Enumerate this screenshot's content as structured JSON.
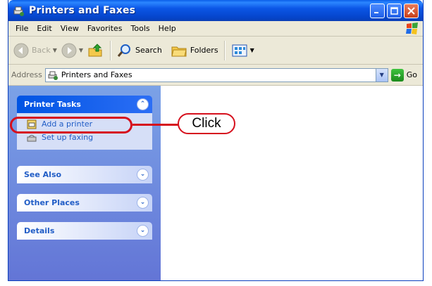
{
  "window": {
    "title": "Printers and Faxes",
    "title_bar_color": "#0a55e0"
  },
  "menu": {
    "items": [
      "File",
      "Edit",
      "View",
      "Favorites",
      "Tools",
      "Help"
    ]
  },
  "toolbar": {
    "back_label": "Back",
    "search_label": "Search",
    "folders_label": "Folders"
  },
  "address": {
    "label": "Address",
    "value": "Printers and Faxes",
    "go_label": "Go"
  },
  "taskpane": {
    "printer_tasks": {
      "title": "Printer Tasks",
      "items": [
        "Add a printer",
        "Set up faxing"
      ]
    },
    "see_also": {
      "title": "See Also"
    },
    "other_places": {
      "title": "Other Places"
    },
    "details": {
      "title": "Details"
    }
  },
  "annotation": {
    "label": "Click",
    "color": "#d6101d"
  }
}
